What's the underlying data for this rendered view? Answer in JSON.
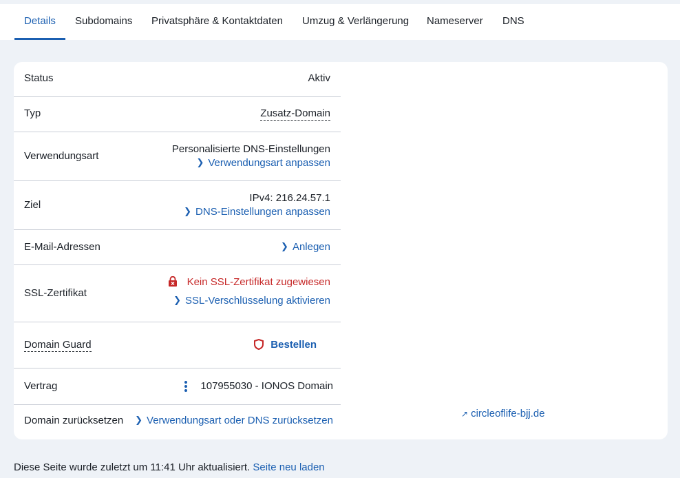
{
  "tabs": [
    {
      "label": "Details",
      "active": true
    },
    {
      "label": "Subdomains"
    },
    {
      "label": "Privatsphäre & Kontaktdaten"
    },
    {
      "label": "Umzug & Verlängerung"
    },
    {
      "label": "Nameserver"
    },
    {
      "label": "DNS"
    }
  ],
  "details": {
    "status": {
      "label": "Status",
      "value": "Aktiv"
    },
    "typ": {
      "label": "Typ",
      "value": "Zusatz-Domain"
    },
    "verwendungsart": {
      "label": "Verwendungsart",
      "value": "Personalisierte DNS-Einstellungen",
      "link": "Verwendungsart anpassen"
    },
    "ziel": {
      "label": "Ziel",
      "value": "IPv4: 216.24.57.1",
      "link": "DNS-Einstellungen anpassen"
    },
    "email": {
      "label": "E-Mail-Adressen",
      "link": "Anlegen"
    },
    "ssl": {
      "label": "SSL-Zertifikat",
      "status": "Kein SSL-Zertifikat zugewiesen",
      "link": "SSL-Verschlüsselung aktivieren"
    },
    "guard": {
      "label": "Domain Guard",
      "link": "Bestellen"
    },
    "vertrag": {
      "label": "Vertrag",
      "value": "107955030 - IONOS Domain"
    },
    "reset": {
      "label": "Domain zurücksetzen",
      "link": "Verwendungsart oder DNS zurücksetzen"
    }
  },
  "domain_link": "circleoflife-bjj.de",
  "footer": {
    "text": "Diese Seite wurde zuletzt um 11:41 Uhr aktualisiert.",
    "reload": "Seite neu laden"
  },
  "colors": {
    "accent": "#1b5fb1",
    "error": "#c62828",
    "background": "#eef2f7"
  },
  "icons": [
    "lock-icon",
    "shield-icon",
    "chevron-right-icon",
    "external-link-icon",
    "kebab-menu-icon"
  ]
}
